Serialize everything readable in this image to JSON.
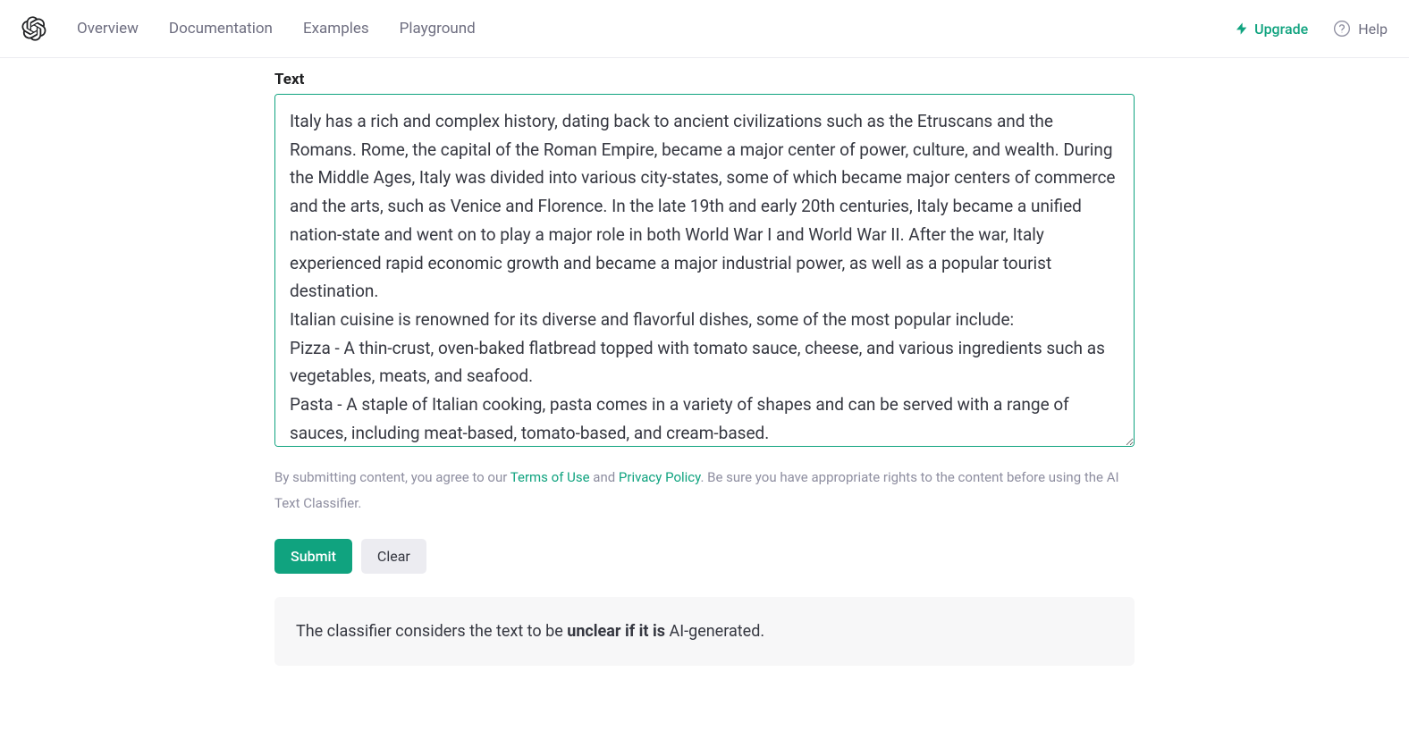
{
  "nav": {
    "overview": "Overview",
    "documentation": "Documentation",
    "examples": "Examples",
    "playground": "Playground"
  },
  "header_right": {
    "upgrade": "Upgrade",
    "help": "Help"
  },
  "main": {
    "label": "Text",
    "textarea_value": "Italy has a rich and complex history, dating back to ancient civilizations such as the Etruscans and the Romans. Rome, the capital of the Roman Empire, became a major center of power, culture, and wealth. During the Middle Ages, Italy was divided into various city-states, some of which became major centers of commerce and the arts, such as Venice and Florence. In the late 19th and early 20th centuries, Italy became a unified nation-state and went on to play a major role in both World War I and World War II. After the war, Italy experienced rapid economic growth and became a major industrial power, as well as a popular tourist destination.\nItalian cuisine is renowned for its diverse and flavorful dishes, some of the most popular include:\nPizza - A thin-crust, oven-baked flatbread topped with tomato sauce, cheese, and various ingredients such as vegetables, meats, and seafood.\nPasta - A staple of Italian cooking, pasta comes in a variety of shapes and can be served with a range of sauces, including meat-based, tomato-based, and cream-based.",
    "disclaimer_prefix": "By submitting content, you agree to our ",
    "terms_label": "Terms of Use",
    "disclaimer_and": " and ",
    "privacy_label": "Privacy Policy",
    "disclaimer_suffix": ". Be sure you have appropriate rights to the content before using the AI Text Classifier.",
    "submit_label": "Submit",
    "clear_label": "Clear"
  },
  "result": {
    "prefix": "The classifier considers the text to be ",
    "bold": "unclear if it is ",
    "suffix": "AI-generated."
  }
}
